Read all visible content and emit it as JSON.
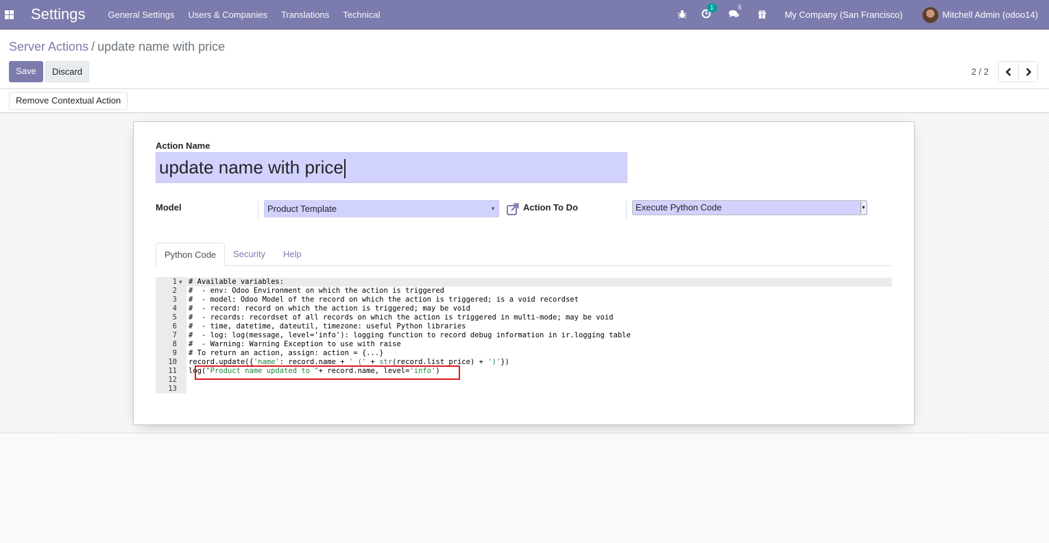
{
  "navbar": {
    "app_title": "Settings",
    "menu": [
      "General Settings",
      "Users & Companies",
      "Translations",
      "Technical"
    ],
    "activity_badge": "1",
    "messages_badge": "5",
    "company": "My Company (San Francisco)",
    "user": "Mitchell Admin (odoo14)",
    "icons": {
      "apps": "apps-grid-icon",
      "debug": "bug-icon",
      "activity": "clock-icon",
      "messages": "chat-icon",
      "gift": "gift-icon"
    },
    "brand_color": "#7c7bad"
  },
  "breadcrumb": {
    "parent": "Server Actions",
    "separator": "/",
    "current": "update name with price"
  },
  "toolbar": {
    "save_label": "Save",
    "discard_label": "Discard"
  },
  "pager": {
    "value": "2 / 2",
    "prev_icon": "chevron-left-icon",
    "next_icon": "chevron-right-icon"
  },
  "statusbar": {
    "remove_contextual_action_label": "Remove Contextual Action"
  },
  "form": {
    "action_name_label": "Action Name",
    "action_name_value": "update name with price",
    "model_label": "Model",
    "model_value": "Product Template",
    "action_to_do_label": "Action To Do",
    "action_to_do_value": "Execute Python Code",
    "tabs": [
      {
        "label": "Python Code",
        "active": true
      },
      {
        "label": "Security",
        "active": false
      },
      {
        "label": "Help",
        "active": false
      }
    ]
  },
  "code_editor": {
    "lines": [
      "# Available variables:",
      "#  - env: Odoo Environment on which the action is triggered",
      "#  - model: Odoo Model of the record on which the action is triggered; is a void recordset",
      "#  - record: record on which the action is triggered; may be void",
      "#  - records: recordset of all records on which the action is triggered in multi-mode; may be void",
      "#  - time, datetime, dateutil, timezone: useful Python libraries",
      "#  - log: log(message, level='info'): logging function to record debug information in ir.logging table",
      "#  - Warning: Warning Exception to use with raise",
      "# To return an action, assign: action = {...}",
      "record.update({'name': record.name + ' (' + str(record.list_price) + ')'})",
      "log(\"Product name updated to \"+ record.name, level='info')",
      "",
      ""
    ],
    "line_numbers": [
      "1",
      "2",
      "3",
      "4",
      "5",
      "6",
      "7",
      "8",
      "9",
      "10",
      "11",
      "12",
      "13"
    ],
    "highlighted_line": 11,
    "highlight_color": "#e0161e"
  }
}
